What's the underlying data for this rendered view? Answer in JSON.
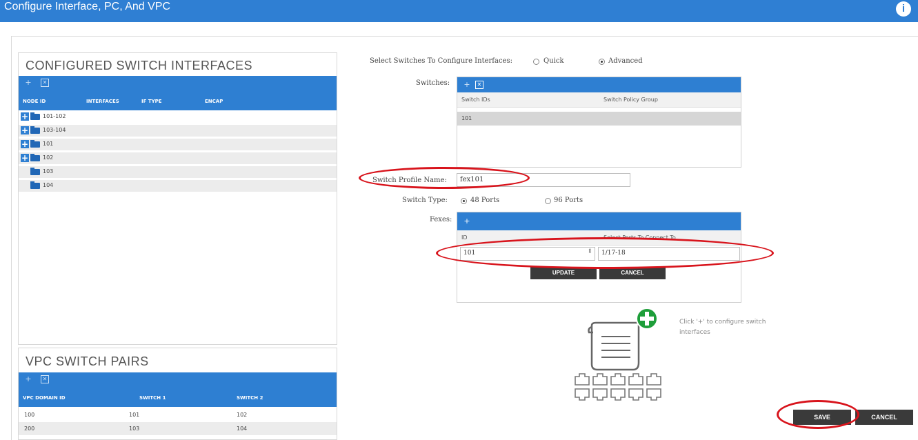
{
  "window": {
    "title": "Configure Interface, PC, And VPC"
  },
  "configured_panel": {
    "title": "CONFIGURED SWITCH INTERFACES",
    "columns": [
      "NODE ID",
      "INTERFACES",
      "IF TYPE",
      "ENCAP"
    ],
    "nodes": [
      "101-102",
      "103-104",
      "101",
      "102",
      "103",
      "104"
    ]
  },
  "vpc_panel": {
    "title": "VPC SWITCH PAIRS",
    "columns": [
      "VPC DOMAIN ID",
      "SWITCH 1",
      "SWITCH 2"
    ],
    "rows": [
      {
        "domain": "100",
        "switch1": "101",
        "switch2": "102"
      },
      {
        "domain": "200",
        "switch1": "103",
        "switch2": "104"
      }
    ]
  },
  "form": {
    "select_label": "Select Switches To Configure Interfaces:",
    "quick_label": "Quick",
    "advanced_label": "Advanced",
    "mode_selected": "Advanced",
    "switches_label": "Switches:",
    "switches_columns": [
      "Switch IDs",
      "Switch Policy Group"
    ],
    "switches_rows": [
      "101"
    ],
    "profile_label": "Switch Profile Name:",
    "profile_value": "fex101",
    "switch_type_label": "Switch Type:",
    "ports48_label": "48 Ports",
    "ports96_label": "96 Ports",
    "switch_type_selected": "48 Ports",
    "fexes_label": "Fexes:",
    "fexes_columns": [
      "ID",
      "Select Ports To Connect To"
    ],
    "fex_id_value": "101",
    "fex_ports_value": "1/17-18",
    "update_label": "UPDATE",
    "cancel_inline_label": "CANCEL",
    "hint": "Click '+' to configure switch interfaces"
  },
  "footer": {
    "save_label": "SAVE",
    "cancel_label": "CANCEL"
  },
  "colors": {
    "accent": "#2e7fd2",
    "annotation": "#d8141c",
    "button_dark": "#3a3a3a",
    "plus_green": "#1e9e3a"
  }
}
